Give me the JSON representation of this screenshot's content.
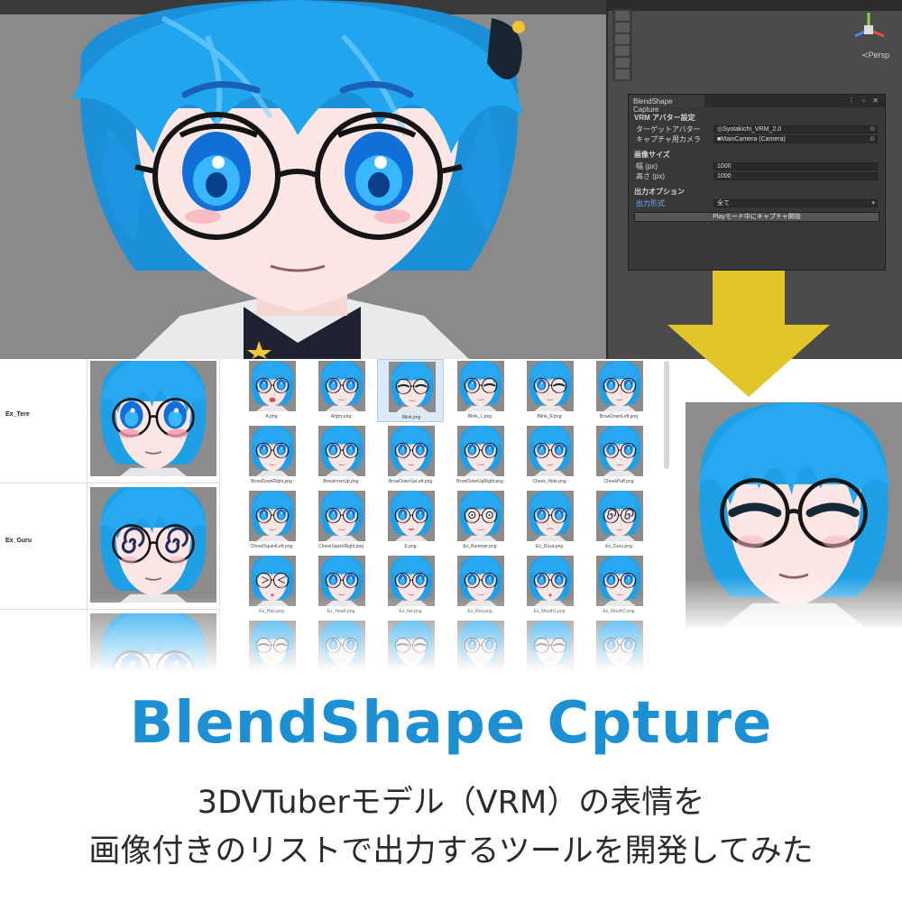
{
  "window": {
    "title": "BlendShape Capture",
    "sections": {
      "avatar": "VRM アバター設定",
      "size": "画像サイズ",
      "output": "出力オプション"
    },
    "fields": {
      "target_label": "ターゲットアバター",
      "target_value": "Syotakichi_VRM_2.0",
      "camera_label": "キャプチャ用カメラ",
      "camera_value": "MainCamera (Camera)",
      "width_label": "幅 (px)",
      "width_value": "1000",
      "height_label": "高さ (px)",
      "height_value": "1000",
      "format_label": "出力形式",
      "format_value": "全て"
    },
    "capture_button": "Playモード中にキャプチャ開始"
  },
  "scene": {
    "persp_label": "≺Persp"
  },
  "list": {
    "rows": [
      {
        "name": "Ex_Tere",
        "expr": "tere"
      },
      {
        "name": "Ex_Guru",
        "expr": "guru"
      },
      {
        "name": "",
        "expr": "neutral"
      }
    ]
  },
  "grid": {
    "items": [
      {
        "label": "A.png",
        "expr": "A"
      },
      {
        "label": "Angry.png",
        "expr": "angry"
      },
      {
        "label": "Blink.png",
        "expr": "blink"
      },
      {
        "label": "Blink_L.png",
        "expr": "wink"
      },
      {
        "label": "Blink_R.png",
        "expr": "wink"
      },
      {
        "label": "BrowDownLeft.png",
        "expr": "neutral"
      },
      {
        "label": "BrowDownRight.png",
        "expr": "neutral"
      },
      {
        "label": "BrowInnerUp.png",
        "expr": "neutral"
      },
      {
        "label": "BrowOuterUpLeft.png",
        "expr": "neutral"
      },
      {
        "label": "BrowOuterUpRight.png",
        "expr": "neutral"
      },
      {
        "label": "Cheek_Hide.png",
        "expr": "neutral"
      },
      {
        "label": "CheekPuff.png",
        "expr": "neutral"
      },
      {
        "label": "CheekSquintLeft.png",
        "expr": "neutral"
      },
      {
        "label": "CheekSquintRight.png",
        "expr": "neutral"
      },
      {
        "label": "E.png",
        "expr": "E"
      },
      {
        "label": "Ex_Bummer.png",
        "expr": "bummer"
      },
      {
        "label": "Ex_Doya.png",
        "expr": "doya"
      },
      {
        "label": "Ex_Guru.png",
        "expr": "guru"
      },
      {
        "label": "Ex_Hau.png",
        "expr": "hau"
      },
      {
        "label": "Ex_Heart.png",
        "expr": "neutral"
      },
      {
        "label": "Ex_Ike.png",
        "expr": "neutral"
      },
      {
        "label": "Ex_Kira.png",
        "expr": "neutral"
      },
      {
        "label": "Ex_Mouth1.png",
        "expr": "O"
      },
      {
        "label": "Ex_Mouth2.png",
        "expr": "neutral"
      },
      {
        "label": "",
        "expr": "blink"
      },
      {
        "label": "",
        "expr": "neutral"
      },
      {
        "label": "",
        "expr": "blink"
      },
      {
        "label": "",
        "expr": "neutral"
      },
      {
        "label": "",
        "expr": "blink"
      },
      {
        "label": "",
        "expr": "neutral"
      }
    ]
  },
  "preview": {
    "expr": "blink"
  },
  "headline": {
    "title": "BlendShape Cpture",
    "line1": "3DVTuberモデル（VRM）の表情を",
    "line2": "画像付きのリストで出力するツールを開発してみた"
  },
  "colors": {
    "hair": "#1f9fe6",
    "skin": "#fde6e4",
    "arrow": "#e2c629",
    "title": "#1d8fd3"
  }
}
